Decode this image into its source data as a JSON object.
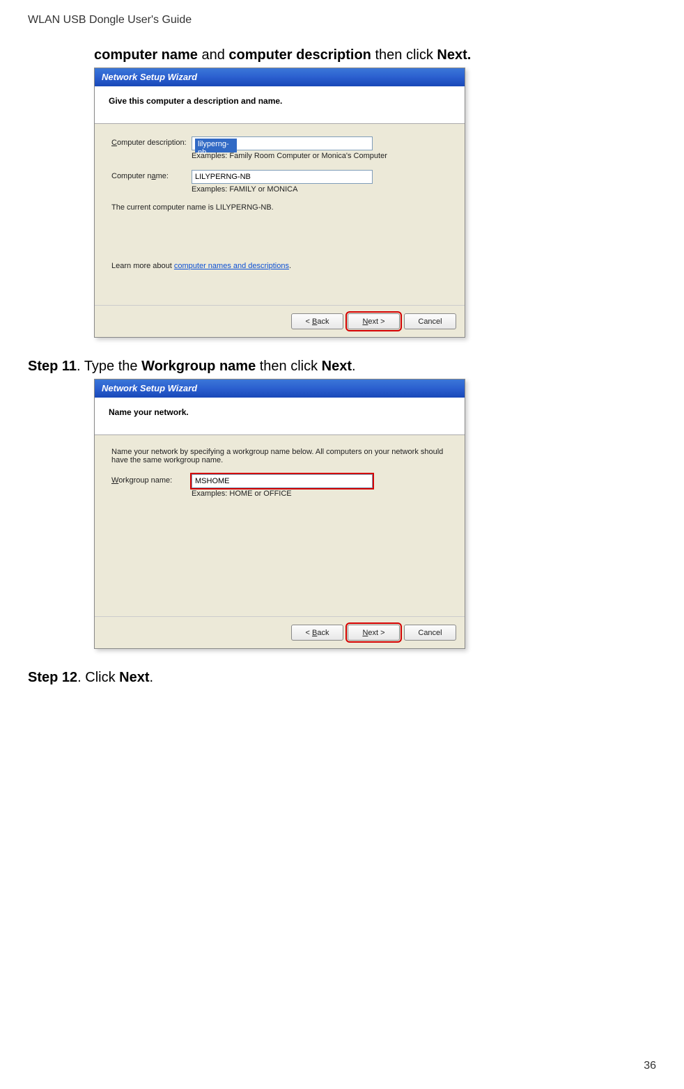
{
  "header": "WLAN USB Dongle User's Guide",
  "intro_line": {
    "pre": "",
    "b1": "computer name",
    "mid": " and ",
    "b2": "computer description",
    "tail": " then click ",
    "b3": "Next."
  },
  "dialog1": {
    "title": "Network Setup Wizard",
    "header": "Give this computer a description and name.",
    "desc_label": "Computer description:",
    "desc_value": "lilyperng-nb",
    "desc_example": "Examples: Family Room Computer or Monica's Computer",
    "name_label": "Computer name:",
    "name_value": "LILYPERNG-NB",
    "name_example": "Examples: FAMILY or MONICA",
    "current": "The current computer name is LILYPERNG-NB.",
    "learn_pre": "Learn more about ",
    "learn_link": "computer names and descriptions",
    "back": "< Back",
    "next": "Next >",
    "cancel": "Cancel"
  },
  "step11": {
    "label": "Step 11",
    "dot": ".    ",
    "pre": "Type the ",
    "b": "Workgroup name",
    "mid": " then click ",
    "b2": "Next",
    "tail": "."
  },
  "dialog2": {
    "title": "Network Setup Wizard",
    "header": "Name your network.",
    "intro": "Name your network by specifying a workgroup name below. All computers on your network should have the same workgroup name.",
    "wg_label": "Workgroup name:",
    "wg_value": "MSHOME",
    "wg_example": "Examples: HOME or OFFICE",
    "back": "< Back",
    "next": "Next >",
    "cancel": "Cancel"
  },
  "step12": {
    "label": "Step 12",
    "dot": ".    ",
    "pre": "Click ",
    "b": "Next",
    "tail": "."
  },
  "page": "36"
}
